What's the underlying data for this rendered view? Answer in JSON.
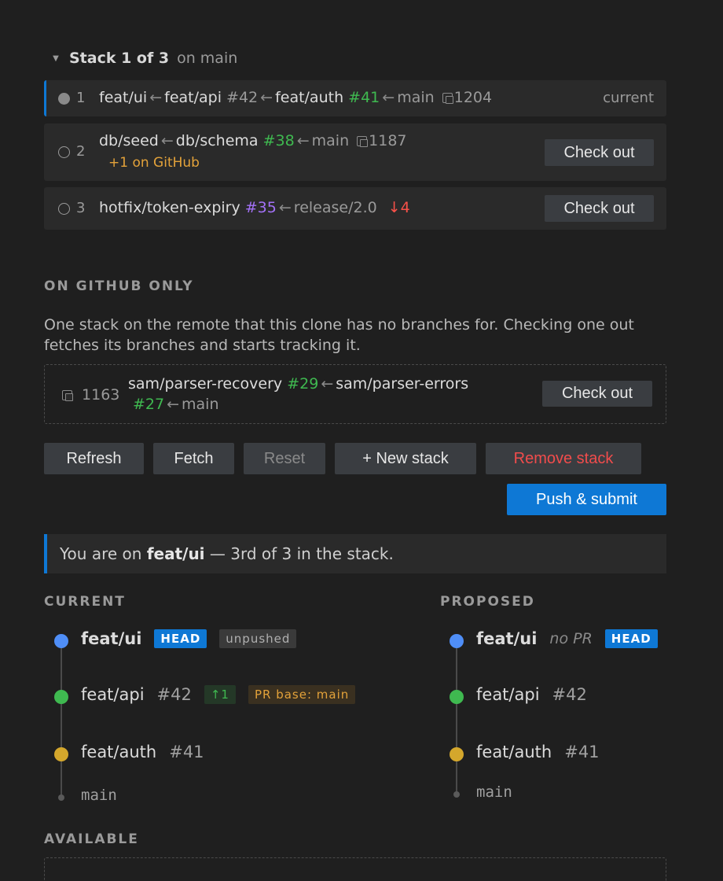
{
  "stack": {
    "title": "Stack 1 of 3",
    "subtitle": "on main",
    "rows": [
      {
        "num": "1",
        "branches": [
          "feat/ui",
          "feat/api",
          "feat/auth",
          "main"
        ],
        "prs": [
          "",
          "#42",
          "#41",
          ""
        ],
        "id": "1204",
        "status": "current"
      },
      {
        "num": "2",
        "branches": [
          "db/seed",
          "db/schema",
          "main"
        ],
        "prs": [
          "",
          "#38",
          ""
        ],
        "id": "1187",
        "note": "+1 on GitHub",
        "action": "Check out"
      },
      {
        "num": "3",
        "branches": [
          "hotfix/token-expiry",
          "release/2.0"
        ],
        "prs": [
          "#35",
          ""
        ],
        "behind": "↓4",
        "action": "Check out"
      }
    ]
  },
  "github_only": {
    "label": "ON GITHUB ONLY",
    "description": "One stack on the remote that this clone has no branches for. Checking one out fetches its branches and starts tracking it.",
    "item": {
      "id": "1163",
      "branches": [
        "sam/parser-recovery",
        "sam/parser-errors",
        "main"
      ],
      "prs": [
        "#29",
        "#27",
        ""
      ],
      "action": "Check out"
    }
  },
  "toolbar": {
    "refresh": "Refresh",
    "fetch": "Fetch",
    "reset": "Reset",
    "new_stack": "+ New stack",
    "remove_stack": "Remove stack",
    "push_submit": "Push & submit"
  },
  "info": {
    "prefix": "You are on ",
    "branch": "feat/ui",
    "suffix": " — 3rd of 3 in the stack."
  },
  "current": {
    "label": "CURRENT",
    "nodes": [
      {
        "name": "feat/ui",
        "head": "HEAD",
        "extra": "unpushed"
      },
      {
        "name": "feat/api",
        "pr": "#42",
        "ahead": "↑1",
        "base": "PR base: main"
      },
      {
        "name": "feat/auth",
        "pr": "#41"
      },
      {
        "name": "main"
      }
    ]
  },
  "proposed": {
    "label": "PROPOSED",
    "nodes": [
      {
        "name": "feat/ui",
        "nopr": "no PR",
        "head": "HEAD"
      },
      {
        "name": "feat/api",
        "pr": "#42"
      },
      {
        "name": "feat/auth",
        "pr": "#41"
      },
      {
        "name": "main"
      }
    ]
  },
  "available": {
    "label": "AVAILABLE"
  },
  "colors": {
    "accent": "#0e78d5",
    "blue_dot": "#4f8ef7",
    "green_dot": "#3fb950",
    "yellow_dot": "#d4a72c",
    "pr_green": "#3fb950",
    "pr_purple": "#a371f7",
    "danger": "#f14c4c",
    "warning": "#e3a23a"
  }
}
